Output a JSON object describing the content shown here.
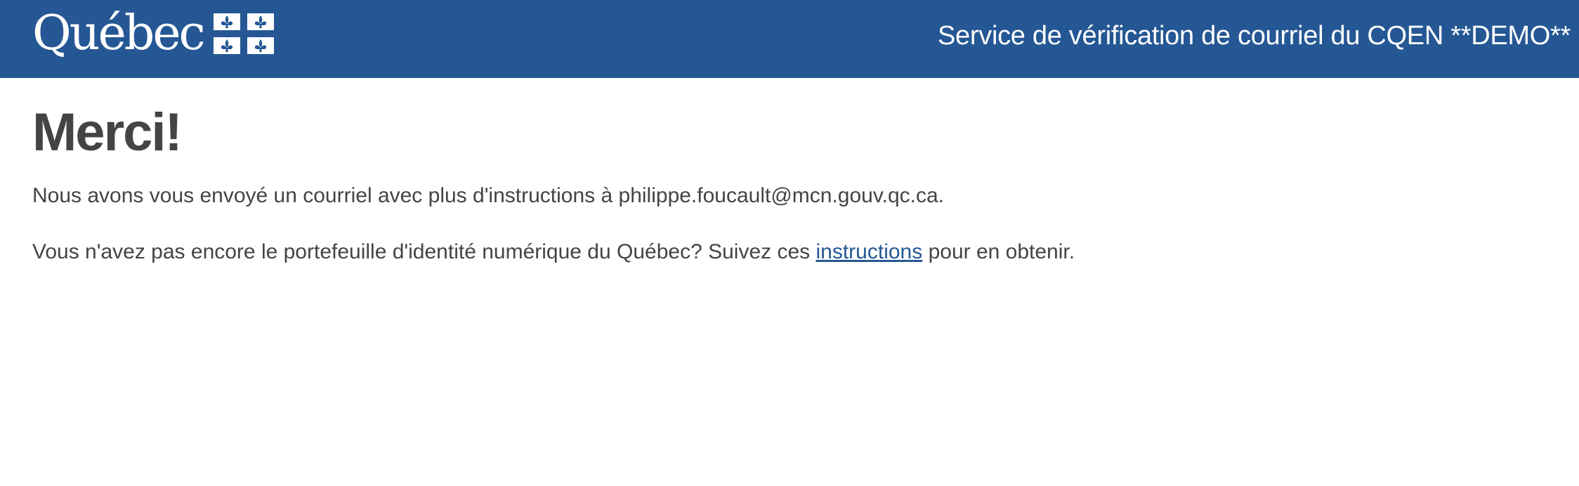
{
  "header": {
    "logo_text": "Québec",
    "service_title": "Service de vérification de courriel du CQEN **DEMO**"
  },
  "main": {
    "title": "Merci!",
    "paragraph1": {
      "text_before_email": "Nous avons vous envoyé un courriel avec plus d'instructions à ",
      "email": "philippe.foucault@mcn.gouv.qc.ca",
      "text_after_email": "."
    },
    "paragraph2": {
      "text_before_link": "Vous n'avez pas encore le portefeuille d'identité numérique du Québec? Suivez ces ",
      "link_label": "instructions",
      "text_after_link": " pour en obtenir."
    }
  },
  "colors": {
    "header_background": "#255794",
    "text": "#444444",
    "link": "#255794"
  }
}
